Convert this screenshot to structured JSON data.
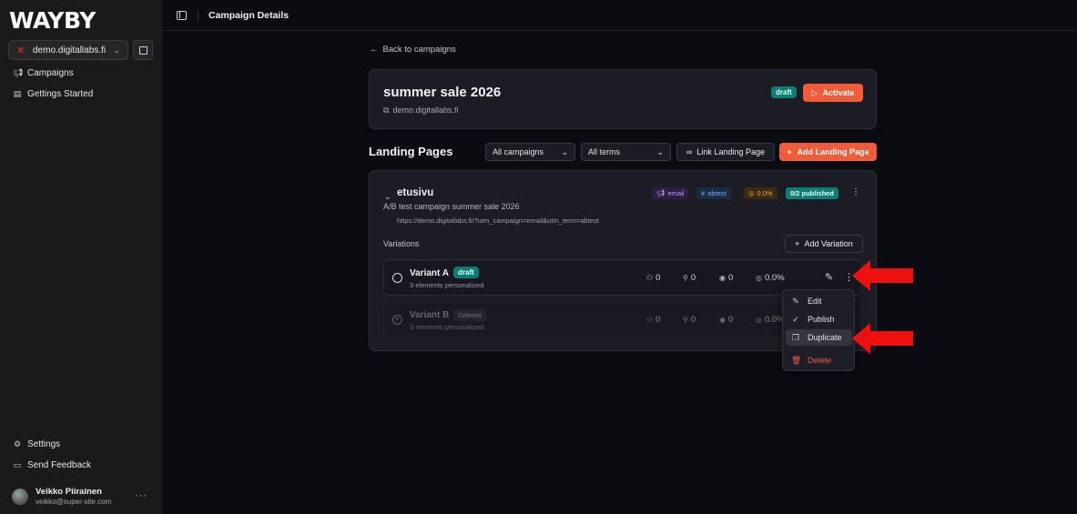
{
  "brand": {
    "logo_text": "WAYBY",
    "accent": "#f35c3a",
    "teal": "#0f7d73"
  },
  "sidebar": {
    "site": "demo.digitallabs.fi",
    "items": [
      {
        "label": "Campaigns",
        "icon": "megaphone-icon"
      },
      {
        "label": "Gettings Started",
        "icon": "clipboard-icon"
      }
    ],
    "bottom_items": [
      {
        "label": "Settings",
        "icon": "gear-icon"
      },
      {
        "label": "Send Feedback",
        "icon": "chat-icon"
      }
    ],
    "user": {
      "name": "Veikko Piirainen",
      "email": "veikko@super-site.com",
      "more": "···"
    }
  },
  "header": {
    "title": "Campaign Details"
  },
  "back_link": "Back to campaigns",
  "campaign": {
    "name": "summer sale 2026",
    "site": "demo.digitallabs.fi",
    "status": "draft",
    "activate_label": "Activate"
  },
  "landing_pages": {
    "heading": "Landing Pages",
    "filter_campaign": "All campaigns",
    "filter_terms": "All terms",
    "link_label": "Link Landing Page",
    "add_label": "Add Landing Page",
    "page": {
      "name": "etusivu",
      "description": "A/B test campaign summer sale 2026",
      "url": "https://demo.digitallabs.fi/?utm_campaign=email&utm_term=abtest",
      "tags": {
        "source": "email",
        "term": "abtest",
        "rate": "0.0%",
        "published": "0/2 published"
      },
      "variations_label": "Variations",
      "add_variation_label": "Add Variation",
      "variants": [
        {
          "name": "Variant A",
          "status": "draft",
          "sub": "3 elements personalized",
          "visitors": "0",
          "clicks": "0",
          "views": "0",
          "conversion": "0.0%"
        },
        {
          "name": "Variant B",
          "status": "Deleted",
          "sub": "3 elements personalized",
          "visitors": "0",
          "clicks": "0",
          "views": "0",
          "conversion": "0.0%"
        }
      ]
    }
  },
  "context_menu": {
    "items": [
      {
        "label": "Edit",
        "icon": "pencil-icon"
      },
      {
        "label": "Publish",
        "icon": "check-circle-icon"
      },
      {
        "label": "Duplicate",
        "icon": "copy-icon"
      },
      {
        "label": "Delete",
        "icon": "trash-icon"
      }
    ]
  }
}
